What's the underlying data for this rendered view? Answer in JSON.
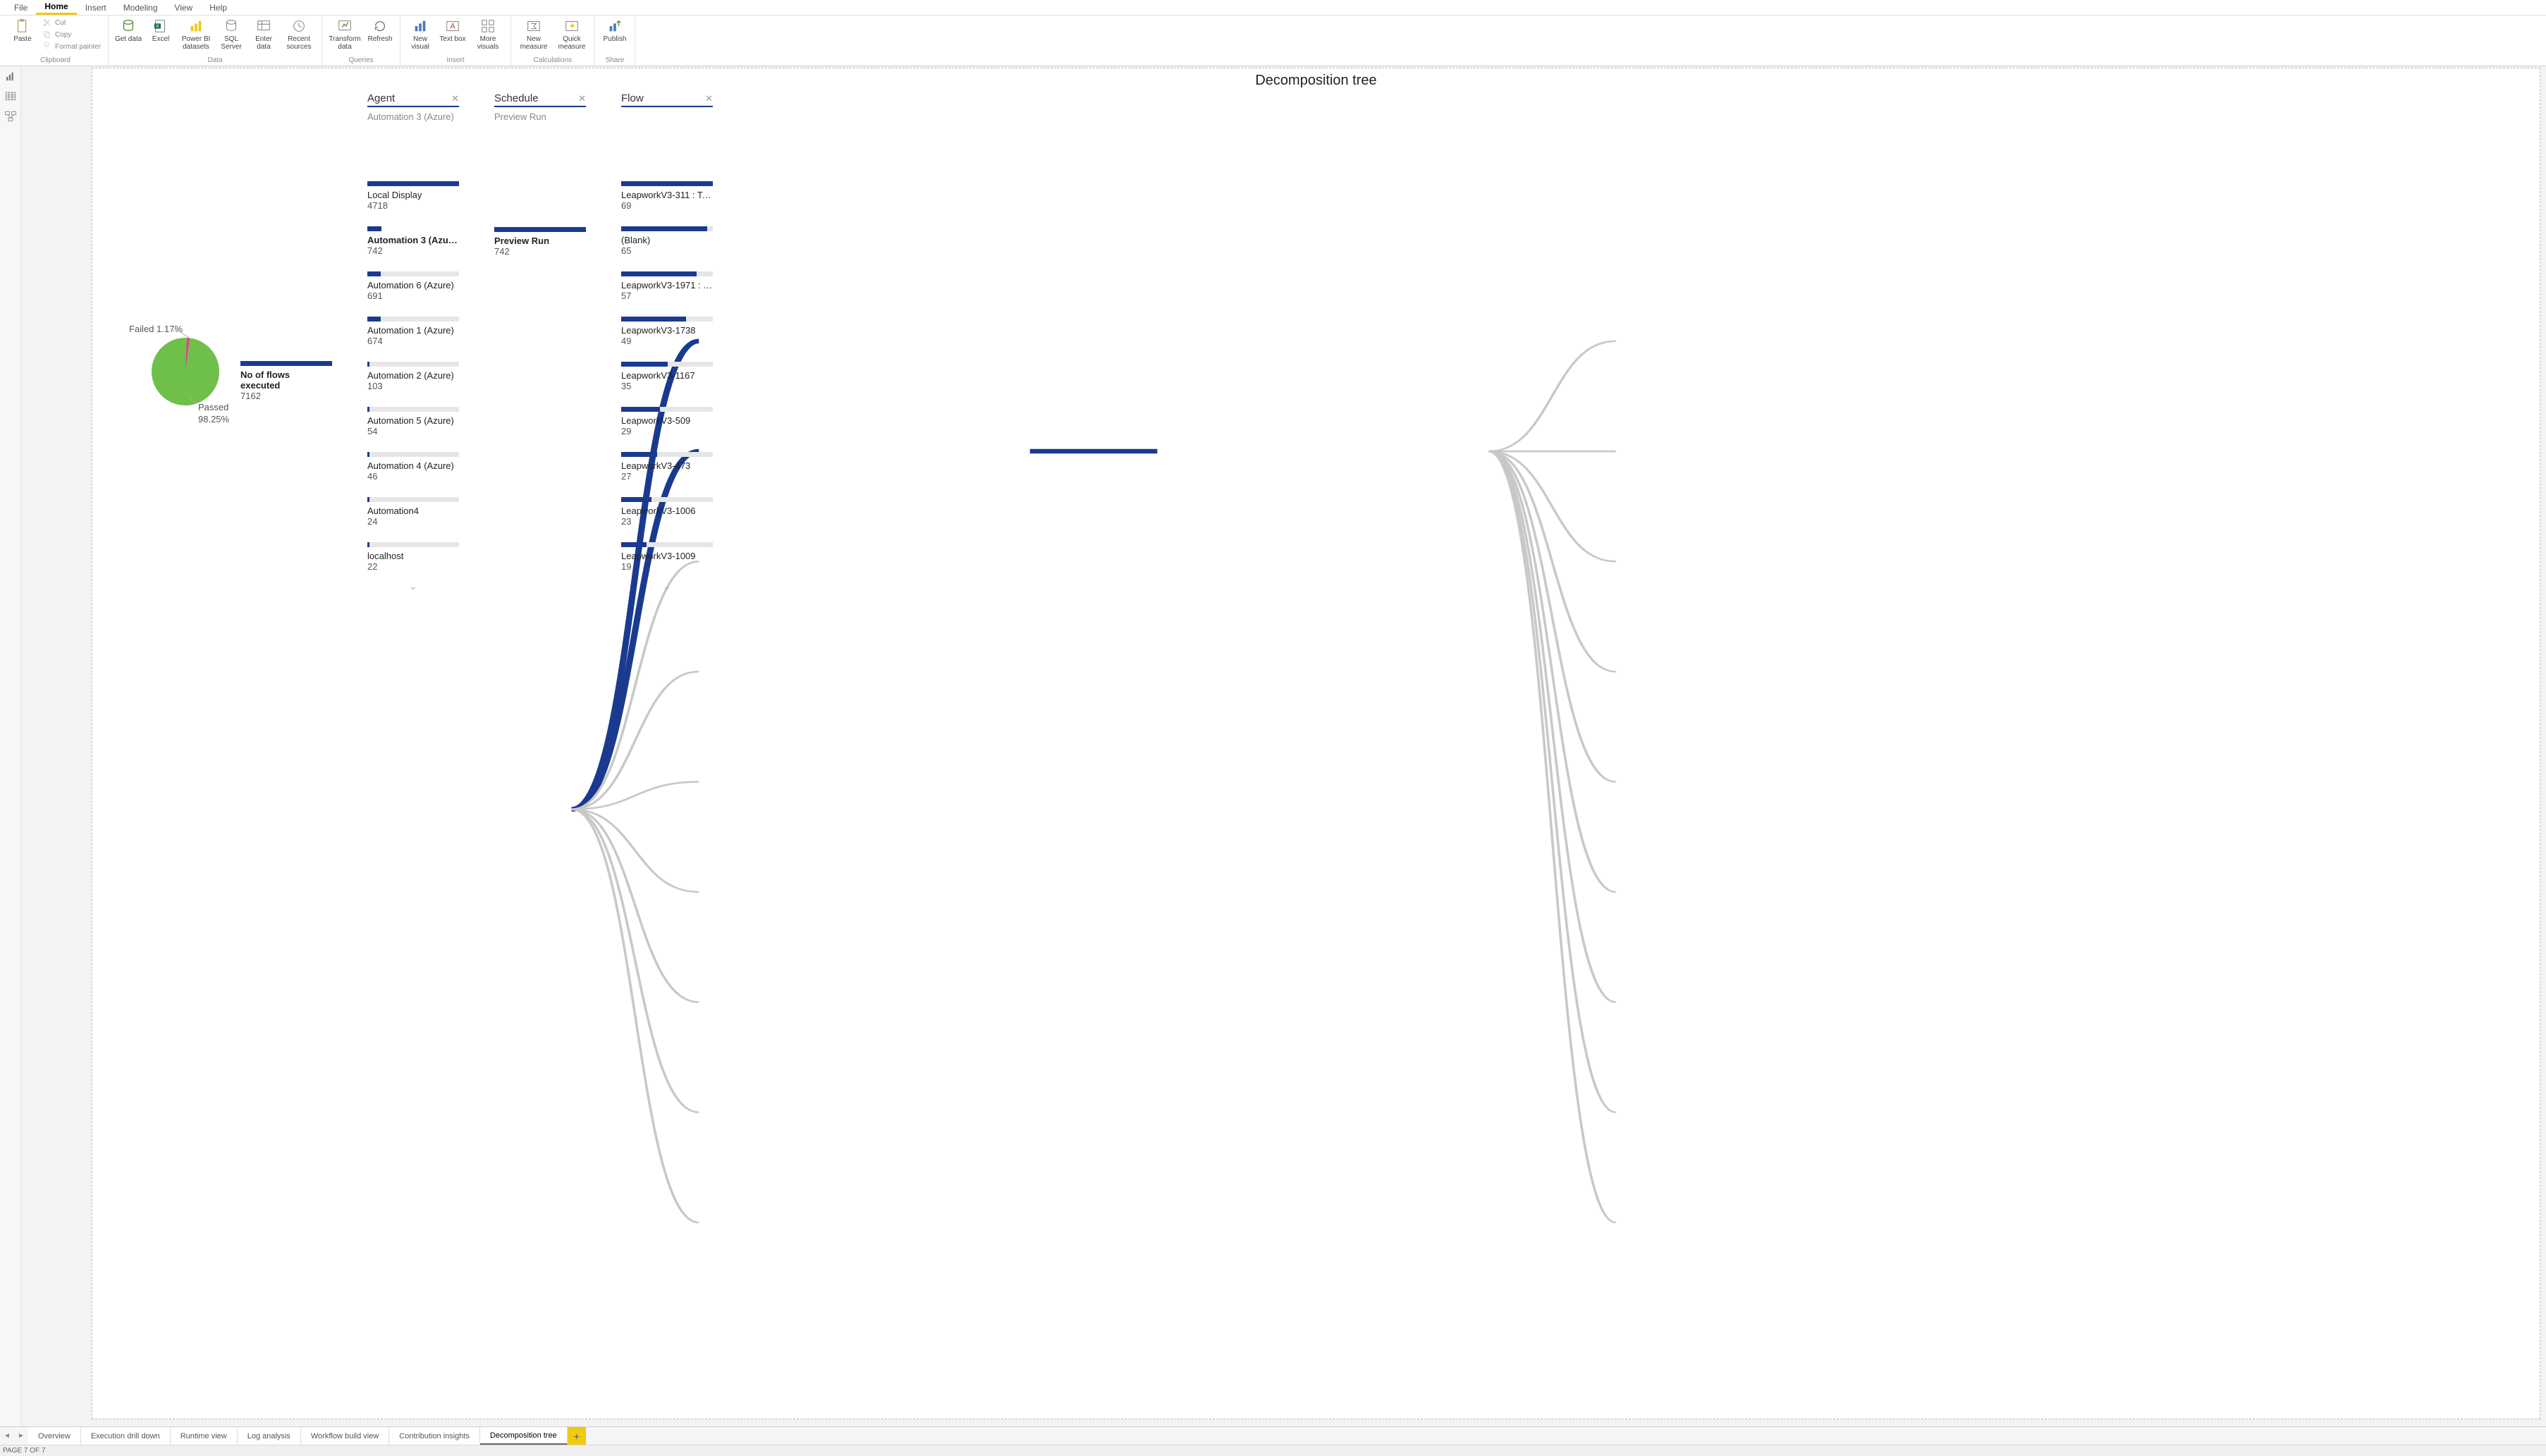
{
  "menu": {
    "file": "File",
    "home": "Home",
    "insert": "Insert",
    "modeling": "Modeling",
    "view": "View",
    "help": "Help"
  },
  "ribbon": {
    "clipboard": {
      "paste": "Paste",
      "cut": "Cut",
      "copy": "Copy",
      "format_painter": "Format painter",
      "group": "Clipboard"
    },
    "data": {
      "get_data": "Get data",
      "excel": "Excel",
      "pbi_datasets": "Power BI datasets",
      "sql": "SQL Server",
      "enter": "Enter data",
      "recent": "Recent sources",
      "group": "Data"
    },
    "queries": {
      "transform": "Transform data",
      "refresh": "Refresh",
      "group": "Queries"
    },
    "insert": {
      "new_visual": "New visual",
      "text_box": "Text box",
      "more_visuals": "More visuals",
      "group": "Insert"
    },
    "calculations": {
      "new_measure": "New measure",
      "quick_measure": "Quick measure",
      "group": "Calculations"
    },
    "share": {
      "publish": "Publish",
      "group": "Share"
    }
  },
  "report_title": "Decomposition tree",
  "chart_data": {
    "type": "pie",
    "title": "",
    "series": [
      {
        "name": "Failed",
        "value_pct": 1.17,
        "label": "Failed 1.17%",
        "color": "#e83e8c"
      },
      {
        "name": "Passed",
        "value_pct": 98.25,
        "label_line1": "Passed",
        "label_line2": "98.25%",
        "color": "#6fbf4b"
      }
    ]
  },
  "decomp": {
    "columns": [
      {
        "title": "Agent",
        "subtitle": "Automation 3 (Azure)"
      },
      {
        "title": "Schedule",
        "subtitle": "Preview Run"
      },
      {
        "title": "Flow",
        "subtitle": ""
      }
    ],
    "root": {
      "title": "No of flows executed",
      "value": "7162"
    },
    "agent_max": 4718,
    "agents": [
      {
        "title": "Local Display",
        "value": 4718
      },
      {
        "title": "Automation 3 (Azure)",
        "value": 742,
        "selected": true
      },
      {
        "title": "Automation 6 (Azure)",
        "value": 691
      },
      {
        "title": "Automation 1 (Azure)",
        "value": 674
      },
      {
        "title": "Automation 2 (Azure)",
        "value": 103
      },
      {
        "title": "Automation 5 (Azure)",
        "value": 54
      },
      {
        "title": "Automation 4 (Azure)",
        "value": 46
      },
      {
        "title": "Automation4",
        "value": 24
      },
      {
        "title": "localhost",
        "value": 22
      }
    ],
    "schedules": [
      {
        "title": "Preview Run",
        "value": 742,
        "selected": true
      }
    ],
    "flow_max": 69,
    "flows": [
      {
        "title": "LeapworkV3-311 : Tok...",
        "value": 69
      },
      {
        "title": "(Blank)",
        "value": 65
      },
      {
        "title": "LeapworkV3-1971 : To...",
        "value": 57
      },
      {
        "title": "LeapworkV3-1738",
        "value": 49
      },
      {
        "title": "LeapworkV3-1167",
        "value": 35
      },
      {
        "title": "LeapworkV3-509",
        "value": 29
      },
      {
        "title": "LeapworkV3-473",
        "value": 27
      },
      {
        "title": "LeapworkV3-1006",
        "value": 23
      },
      {
        "title": "LeapworkV3-1009",
        "value": 19
      }
    ]
  },
  "tabs": {
    "items": [
      "Overview",
      "Execution drill down",
      "Runtime view",
      "Log analysis",
      "Workflow build view",
      "Contribution insights",
      "Decomposition tree"
    ],
    "active_index": 6,
    "add": "+"
  },
  "status": "PAGE 7 OF 7"
}
